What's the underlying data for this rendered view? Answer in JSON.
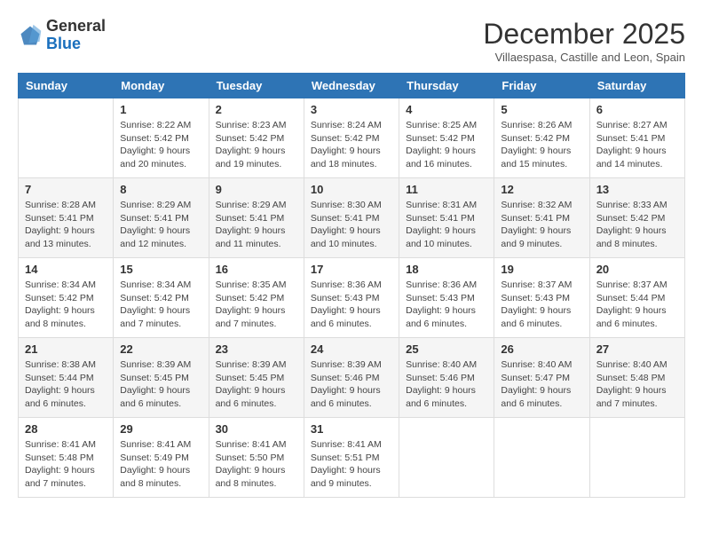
{
  "header": {
    "logo_general": "General",
    "logo_blue": "Blue",
    "month_title": "December 2025",
    "location": "Villaespasa, Castille and Leon, Spain"
  },
  "days_of_week": [
    "Sunday",
    "Monday",
    "Tuesday",
    "Wednesday",
    "Thursday",
    "Friday",
    "Saturday"
  ],
  "weeks": [
    [
      {
        "num": "",
        "sunrise": "",
        "sunset": "",
        "daylight": ""
      },
      {
        "num": "1",
        "sunrise": "Sunrise: 8:22 AM",
        "sunset": "Sunset: 5:42 PM",
        "daylight": "Daylight: 9 hours and 20 minutes."
      },
      {
        "num": "2",
        "sunrise": "Sunrise: 8:23 AM",
        "sunset": "Sunset: 5:42 PM",
        "daylight": "Daylight: 9 hours and 19 minutes."
      },
      {
        "num": "3",
        "sunrise": "Sunrise: 8:24 AM",
        "sunset": "Sunset: 5:42 PM",
        "daylight": "Daylight: 9 hours and 18 minutes."
      },
      {
        "num": "4",
        "sunrise": "Sunrise: 8:25 AM",
        "sunset": "Sunset: 5:42 PM",
        "daylight": "Daylight: 9 hours and 16 minutes."
      },
      {
        "num": "5",
        "sunrise": "Sunrise: 8:26 AM",
        "sunset": "Sunset: 5:42 PM",
        "daylight": "Daylight: 9 hours and 15 minutes."
      },
      {
        "num": "6",
        "sunrise": "Sunrise: 8:27 AM",
        "sunset": "Sunset: 5:41 PM",
        "daylight": "Daylight: 9 hours and 14 minutes."
      }
    ],
    [
      {
        "num": "7",
        "sunrise": "Sunrise: 8:28 AM",
        "sunset": "Sunset: 5:41 PM",
        "daylight": "Daylight: 9 hours and 13 minutes."
      },
      {
        "num": "8",
        "sunrise": "Sunrise: 8:29 AM",
        "sunset": "Sunset: 5:41 PM",
        "daylight": "Daylight: 9 hours and 12 minutes."
      },
      {
        "num": "9",
        "sunrise": "Sunrise: 8:29 AM",
        "sunset": "Sunset: 5:41 PM",
        "daylight": "Daylight: 9 hours and 11 minutes."
      },
      {
        "num": "10",
        "sunrise": "Sunrise: 8:30 AM",
        "sunset": "Sunset: 5:41 PM",
        "daylight": "Daylight: 9 hours and 10 minutes."
      },
      {
        "num": "11",
        "sunrise": "Sunrise: 8:31 AM",
        "sunset": "Sunset: 5:41 PM",
        "daylight": "Daylight: 9 hours and 10 minutes."
      },
      {
        "num": "12",
        "sunrise": "Sunrise: 8:32 AM",
        "sunset": "Sunset: 5:41 PM",
        "daylight": "Daylight: 9 hours and 9 minutes."
      },
      {
        "num": "13",
        "sunrise": "Sunrise: 8:33 AM",
        "sunset": "Sunset: 5:42 PM",
        "daylight": "Daylight: 9 hours and 8 minutes."
      }
    ],
    [
      {
        "num": "14",
        "sunrise": "Sunrise: 8:34 AM",
        "sunset": "Sunset: 5:42 PM",
        "daylight": "Daylight: 9 hours and 8 minutes."
      },
      {
        "num": "15",
        "sunrise": "Sunrise: 8:34 AM",
        "sunset": "Sunset: 5:42 PM",
        "daylight": "Daylight: 9 hours and 7 minutes."
      },
      {
        "num": "16",
        "sunrise": "Sunrise: 8:35 AM",
        "sunset": "Sunset: 5:42 PM",
        "daylight": "Daylight: 9 hours and 7 minutes."
      },
      {
        "num": "17",
        "sunrise": "Sunrise: 8:36 AM",
        "sunset": "Sunset: 5:43 PM",
        "daylight": "Daylight: 9 hours and 6 minutes."
      },
      {
        "num": "18",
        "sunrise": "Sunrise: 8:36 AM",
        "sunset": "Sunset: 5:43 PM",
        "daylight": "Daylight: 9 hours and 6 minutes."
      },
      {
        "num": "19",
        "sunrise": "Sunrise: 8:37 AM",
        "sunset": "Sunset: 5:43 PM",
        "daylight": "Daylight: 9 hours and 6 minutes."
      },
      {
        "num": "20",
        "sunrise": "Sunrise: 8:37 AM",
        "sunset": "Sunset: 5:44 PM",
        "daylight": "Daylight: 9 hours and 6 minutes."
      }
    ],
    [
      {
        "num": "21",
        "sunrise": "Sunrise: 8:38 AM",
        "sunset": "Sunset: 5:44 PM",
        "daylight": "Daylight: 9 hours and 6 minutes."
      },
      {
        "num": "22",
        "sunrise": "Sunrise: 8:39 AM",
        "sunset": "Sunset: 5:45 PM",
        "daylight": "Daylight: 9 hours and 6 minutes."
      },
      {
        "num": "23",
        "sunrise": "Sunrise: 8:39 AM",
        "sunset": "Sunset: 5:45 PM",
        "daylight": "Daylight: 9 hours and 6 minutes."
      },
      {
        "num": "24",
        "sunrise": "Sunrise: 8:39 AM",
        "sunset": "Sunset: 5:46 PM",
        "daylight": "Daylight: 9 hours and 6 minutes."
      },
      {
        "num": "25",
        "sunrise": "Sunrise: 8:40 AM",
        "sunset": "Sunset: 5:46 PM",
        "daylight": "Daylight: 9 hours and 6 minutes."
      },
      {
        "num": "26",
        "sunrise": "Sunrise: 8:40 AM",
        "sunset": "Sunset: 5:47 PM",
        "daylight": "Daylight: 9 hours and 6 minutes."
      },
      {
        "num": "27",
        "sunrise": "Sunrise: 8:40 AM",
        "sunset": "Sunset: 5:48 PM",
        "daylight": "Daylight: 9 hours and 7 minutes."
      }
    ],
    [
      {
        "num": "28",
        "sunrise": "Sunrise: 8:41 AM",
        "sunset": "Sunset: 5:48 PM",
        "daylight": "Daylight: 9 hours and 7 minutes."
      },
      {
        "num": "29",
        "sunrise": "Sunrise: 8:41 AM",
        "sunset": "Sunset: 5:49 PM",
        "daylight": "Daylight: 9 hours and 8 minutes."
      },
      {
        "num": "30",
        "sunrise": "Sunrise: 8:41 AM",
        "sunset": "Sunset: 5:50 PM",
        "daylight": "Daylight: 9 hours and 8 minutes."
      },
      {
        "num": "31",
        "sunrise": "Sunrise: 8:41 AM",
        "sunset": "Sunset: 5:51 PM",
        "daylight": "Daylight: 9 hours and 9 minutes."
      },
      {
        "num": "",
        "sunrise": "",
        "sunset": "",
        "daylight": ""
      },
      {
        "num": "",
        "sunrise": "",
        "sunset": "",
        "daylight": ""
      },
      {
        "num": "",
        "sunrise": "",
        "sunset": "",
        "daylight": ""
      }
    ]
  ]
}
